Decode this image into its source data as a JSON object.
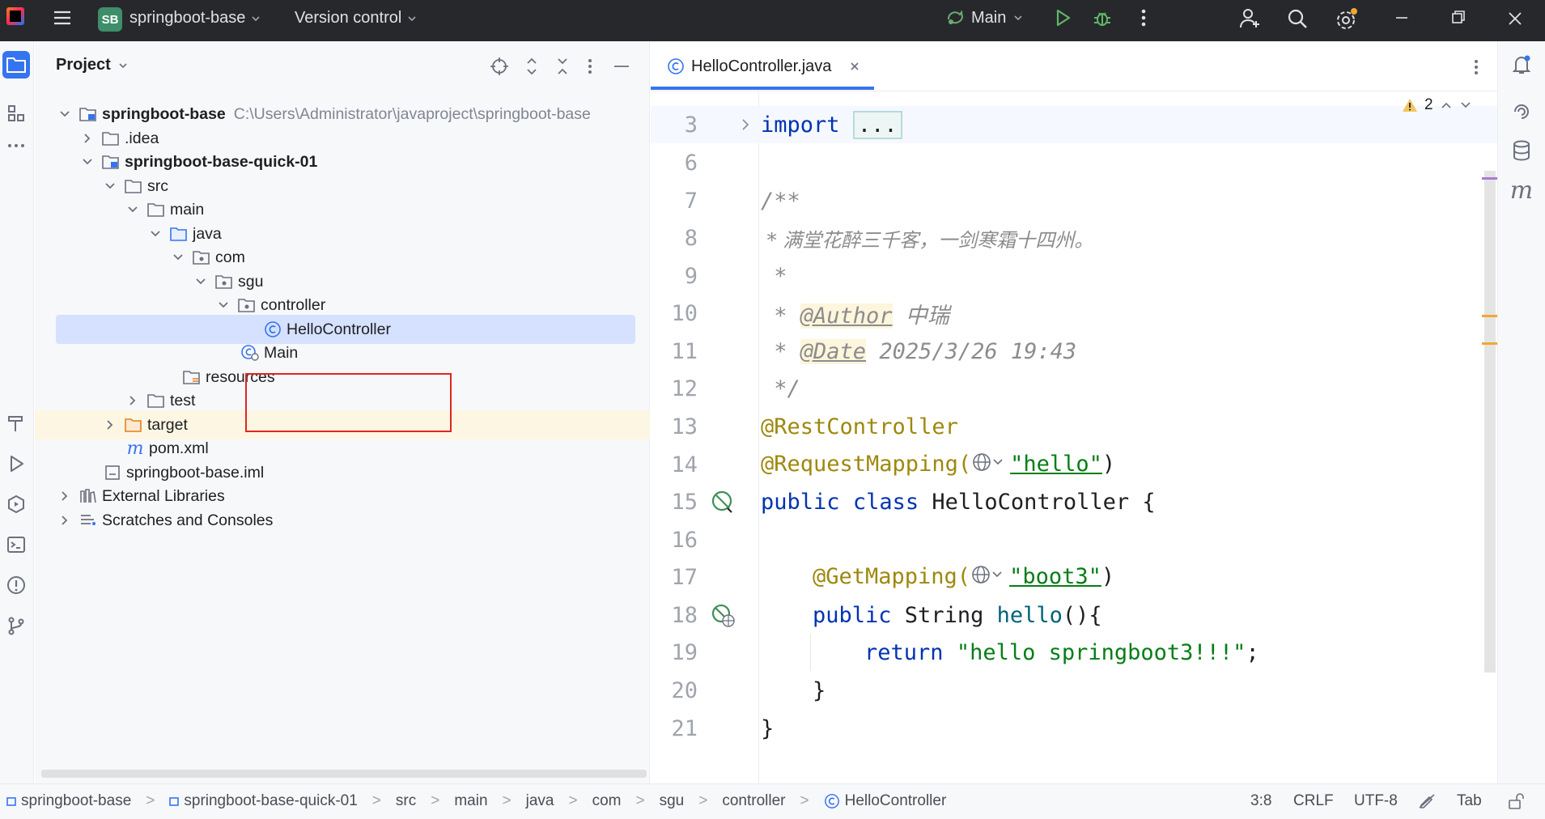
{
  "titlebar": {
    "project_badge": "SB",
    "project_name": "springboot-base",
    "vcs_label": "Version control",
    "run_config": "Main"
  },
  "project_panel": {
    "title": "Project",
    "tree": [
      {
        "label": "springboot-base",
        "path": "C:\\Users\\Administrator\\javaproject\\springboot-base",
        "bold": true
      },
      {
        "label": ".idea"
      },
      {
        "label": "springboot-base-quick-01",
        "bold": true
      },
      {
        "label": "src"
      },
      {
        "label": "main"
      },
      {
        "label": "java"
      },
      {
        "label": "com"
      },
      {
        "label": "sgu"
      },
      {
        "label": "controller"
      },
      {
        "label": "HelloController"
      },
      {
        "label": "Main"
      },
      {
        "label": "resources"
      },
      {
        "label": "test"
      },
      {
        "label": "target"
      },
      {
        "label": "pom.xml"
      },
      {
        "label": "springboot-base.iml"
      },
      {
        "label": "External Libraries"
      },
      {
        "label": "Scratches and Consoles"
      }
    ]
  },
  "editor": {
    "tab_label": "HelloController.java",
    "warning_count": "2",
    "lines": {
      "l3": {
        "num": "3",
        "kw": "import",
        "fold": "..."
      },
      "l6": {
        "num": "6"
      },
      "l7": {
        "num": "7",
        "text": "/**"
      },
      "l8": {
        "num": "8",
        "text": " * 满堂花醉三千客，一剑寒霜十四州。"
      },
      "l9": {
        "num": "9",
        "text": " *"
      },
      "l10": {
        "num": "10",
        "pre": " * ",
        "tag": "@Author",
        "post": " 中瑞"
      },
      "l11": {
        "num": "11",
        "pre": " * ",
        "tag": "@Date",
        "post": " 2025/3/26 19:43"
      },
      "l12": {
        "num": "12",
        "text": " */"
      },
      "l13": {
        "num": "13",
        "ann": "@RestController"
      },
      "l14": {
        "num": "14",
        "ann": "@RequestMapping(",
        "str": "\"hello\"",
        "close": ")"
      },
      "l15": {
        "num": "15",
        "kw1": "public",
        "kw2": "class",
        "rest": " HelloController {"
      },
      "l16": {
        "num": "16"
      },
      "l17": {
        "num": "17",
        "ann": "@GetMapping(",
        "str": "\"boot3\"",
        "close": ")"
      },
      "l18": {
        "num": "18",
        "kw": "public",
        "type": " String ",
        "fn": "hello",
        "rest": "(){"
      },
      "l19": {
        "num": "19",
        "kw": "return",
        "str": "\"hello springboot3!!!\"",
        "rest": ";"
      },
      "l20": {
        "num": "20",
        "text": "}"
      },
      "l21": {
        "num": "21",
        "text": "}"
      }
    }
  },
  "statusbar": {
    "breadcrumbs": [
      "springboot-base",
      "springboot-base-quick-01",
      "src",
      "main",
      "java",
      "com",
      "sgu",
      "controller",
      "HelloController"
    ],
    "position": "3:8",
    "line_sep": "CRLF",
    "encoding": "UTF-8",
    "indent": "Tab"
  },
  "colors": {
    "accent": "#3574f0",
    "keyword": "#0033b3",
    "annotation": "#9e880d",
    "string": "#067d17",
    "selection_box": "#e0261e"
  }
}
